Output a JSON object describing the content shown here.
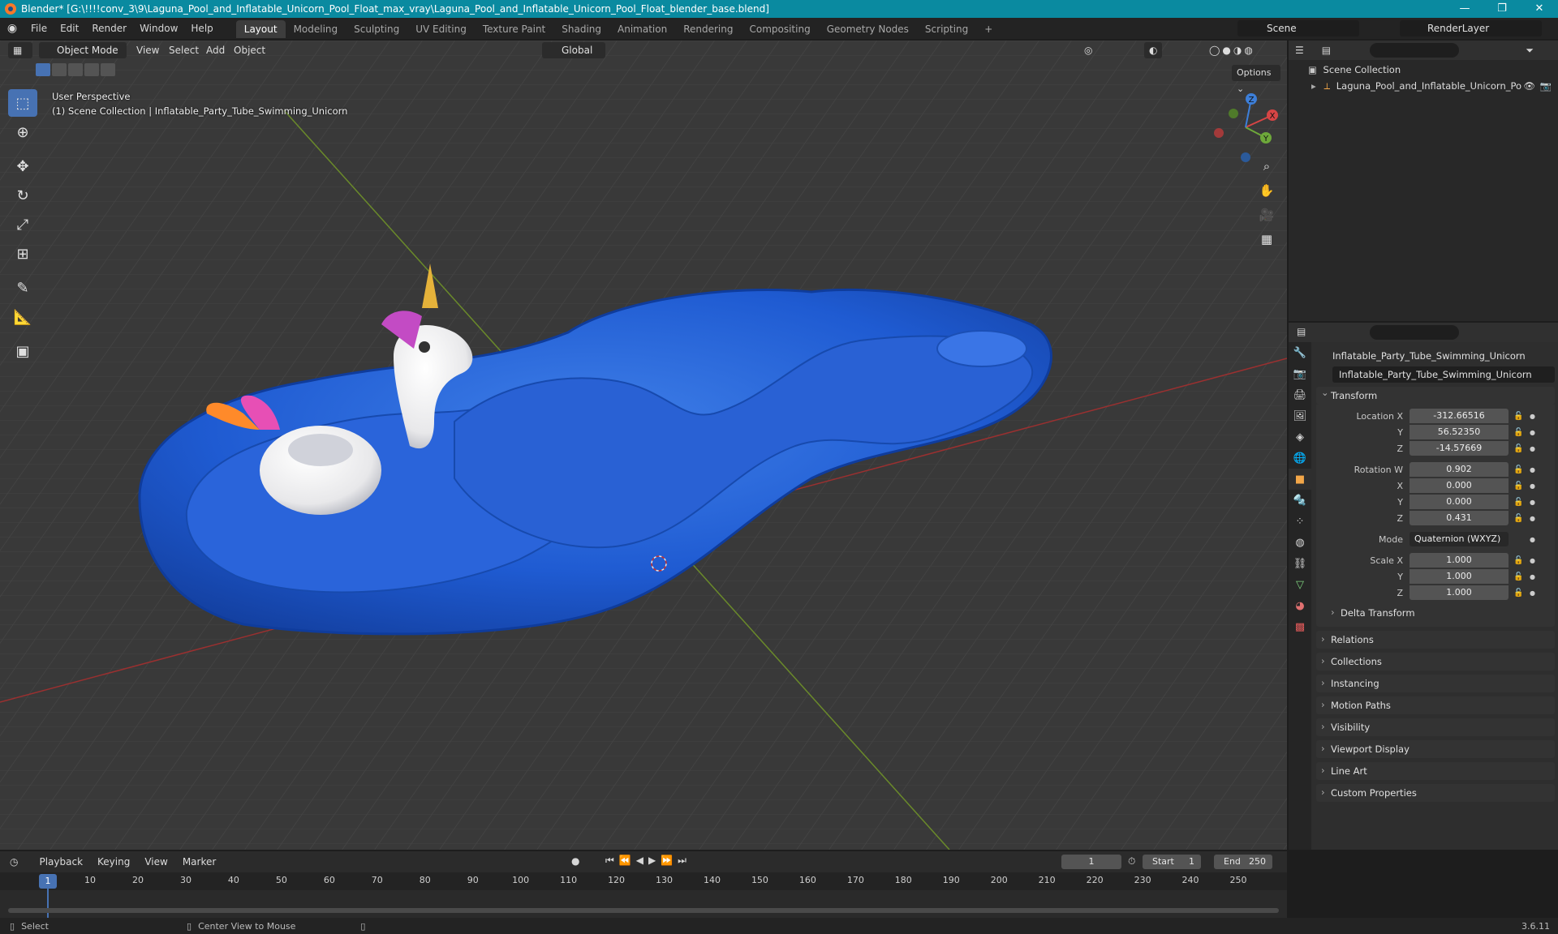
{
  "window": {
    "title": "Blender* [G:\\!!!!conv_3\\9\\Laguna_Pool_and_Inflatable_Unicorn_Pool_Float_max_vray\\Laguna_Pool_and_Inflatable_Unicorn_Pool_Float_blender_base.blend]",
    "minimize": "—",
    "maximize": "❐",
    "close": "✕"
  },
  "menu": {
    "items": [
      "File",
      "Edit",
      "Render",
      "Window",
      "Help"
    ],
    "workspaces": [
      "Layout",
      "Modeling",
      "Sculpting",
      "UV Editing",
      "Texture Paint",
      "Shading",
      "Animation",
      "Rendering",
      "Compositing",
      "Geometry Nodes",
      "Scripting"
    ],
    "active_workspace": "Layout",
    "add_workspace": "+",
    "scene": "Scene",
    "view_layer": "RenderLayer"
  },
  "viewport": {
    "mode": "Object Mode",
    "menus": [
      "View",
      "Select",
      "Add",
      "Object"
    ],
    "orientation": "Global",
    "options": "Options",
    "perspective_label": "User Perspective",
    "collection_label": "(1) Scene Collection | Inflatable_Party_Tube_Swimming_Unicorn",
    "gizmo": {
      "x": "X",
      "y": "Y",
      "z": "Z"
    }
  },
  "outliner": {
    "root": "Scene Collection",
    "items": [
      "Laguna_Pool_and_Inflatable_Unicorn_Po"
    ]
  },
  "properties": {
    "object_name": "Inflatable_Party_Tube_Swimming_Unicorn",
    "data_name": "Inflatable_Party_Tube_Swimming_Unicorn",
    "transform": {
      "title": "Transform",
      "location_label": "Location X",
      "location": [
        "-312.66516",
        "56.52350",
        "-14.57669"
      ],
      "rotation_label": "Rotation W",
      "rotation": [
        "0.902",
        "0.000",
        "0.000",
        "0.431"
      ],
      "mode_label": "Mode",
      "mode": "Quaternion (WXYZ)",
      "scale_label": "Scale X",
      "scale": [
        "1.000",
        "1.000",
        "1.000"
      ],
      "y_label": "Y",
      "z_label": "Z",
      "x_label": "X",
      "delta": "Delta Transform"
    },
    "panels": [
      "Relations",
      "Collections",
      "Instancing",
      "Motion Paths",
      "Visibility",
      "Viewport Display",
      "Line Art",
      "Custom Properties"
    ]
  },
  "timeline": {
    "menus": [
      "Playback",
      "Keying",
      "View",
      "Marker"
    ],
    "current_frame": "1",
    "start_label": "Start",
    "start": "1",
    "end_label": "End",
    "end": "250",
    "ruler": [
      "1",
      "10",
      "20",
      "30",
      "40",
      "50",
      "60",
      "70",
      "80",
      "90",
      "100",
      "110",
      "120",
      "130",
      "140",
      "150",
      "160",
      "170",
      "180",
      "190",
      "200",
      "210",
      "220",
      "230",
      "240",
      "250"
    ]
  },
  "status": {
    "select": "Select",
    "center_view": "Center View to Mouse",
    "version": "3.6.11"
  }
}
